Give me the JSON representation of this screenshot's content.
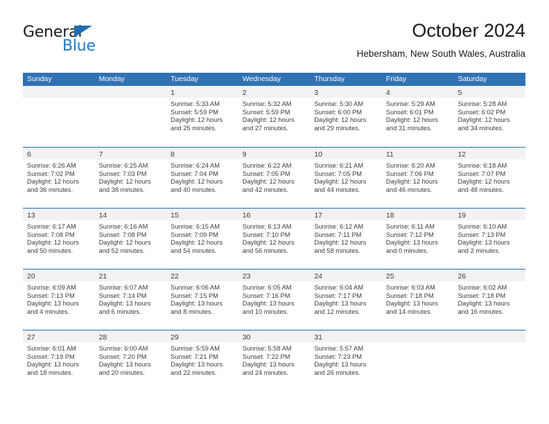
{
  "brand": {
    "word_one": "General",
    "word_two": "Blue",
    "triangle_color": "#1f6cb0",
    "blue_text_color": "#1f7ac4"
  },
  "header": {
    "title": "October 2024",
    "location": "Hebersham, New South Wales, Australia"
  },
  "theme": {
    "header_blue": "#3072b4",
    "rule_blue": "#1f6cb0",
    "daynum_strip_gray": "#f2f2f2",
    "text_color": "#3c3c3c"
  },
  "calendar": {
    "day_names": [
      "Sunday",
      "Monday",
      "Tuesday",
      "Wednesday",
      "Thursday",
      "Friday",
      "Saturday"
    ],
    "weeks": [
      [
        {
          "day": "",
          "lines": []
        },
        {
          "day": "",
          "lines": []
        },
        {
          "day": "1",
          "lines": [
            "Sunrise: 5:33 AM",
            "Sunset: 5:59 PM",
            "Daylight: 12 hours",
            "and 25 minutes."
          ]
        },
        {
          "day": "2",
          "lines": [
            "Sunrise: 5:32 AM",
            "Sunset: 5:59 PM",
            "Daylight: 12 hours",
            "and 27 minutes."
          ]
        },
        {
          "day": "3",
          "lines": [
            "Sunrise: 5:30 AM",
            "Sunset: 6:00 PM",
            "Daylight: 12 hours",
            "and 29 minutes."
          ]
        },
        {
          "day": "4",
          "lines": [
            "Sunrise: 5:29 AM",
            "Sunset: 6:01 PM",
            "Daylight: 12 hours",
            "and 31 minutes."
          ]
        },
        {
          "day": "5",
          "lines": [
            "Sunrise: 5:28 AM",
            "Sunset: 6:02 PM",
            "Daylight: 12 hours",
            "and 34 minutes."
          ]
        }
      ],
      [
        {
          "day": "6",
          "lines": [
            "Sunrise: 6:26 AM",
            "Sunset: 7:02 PM",
            "Daylight: 12 hours",
            "and 36 minutes."
          ]
        },
        {
          "day": "7",
          "lines": [
            "Sunrise: 6:25 AM",
            "Sunset: 7:03 PM",
            "Daylight: 12 hours",
            "and 38 minutes."
          ]
        },
        {
          "day": "8",
          "lines": [
            "Sunrise: 6:24 AM",
            "Sunset: 7:04 PM",
            "Daylight: 12 hours",
            "and 40 minutes."
          ]
        },
        {
          "day": "9",
          "lines": [
            "Sunrise: 6:22 AM",
            "Sunset: 7:05 PM",
            "Daylight: 12 hours",
            "and 42 minutes."
          ]
        },
        {
          "day": "10",
          "lines": [
            "Sunrise: 6:21 AM",
            "Sunset: 7:05 PM",
            "Daylight: 12 hours",
            "and 44 minutes."
          ]
        },
        {
          "day": "11",
          "lines": [
            "Sunrise: 6:20 AM",
            "Sunset: 7:06 PM",
            "Daylight: 12 hours",
            "and 46 minutes."
          ]
        },
        {
          "day": "12",
          "lines": [
            "Sunrise: 6:18 AM",
            "Sunset: 7:07 PM",
            "Daylight: 12 hours",
            "and 48 minutes."
          ]
        }
      ],
      [
        {
          "day": "13",
          "lines": [
            "Sunrise: 6:17 AM",
            "Sunset: 7:08 PM",
            "Daylight: 12 hours",
            "and 50 minutes."
          ]
        },
        {
          "day": "14",
          "lines": [
            "Sunrise: 6:16 AM",
            "Sunset: 7:08 PM",
            "Daylight: 12 hours",
            "and 52 minutes."
          ]
        },
        {
          "day": "15",
          "lines": [
            "Sunrise: 6:15 AM",
            "Sunset: 7:09 PM",
            "Daylight: 12 hours",
            "and 54 minutes."
          ]
        },
        {
          "day": "16",
          "lines": [
            "Sunrise: 6:13 AM",
            "Sunset: 7:10 PM",
            "Daylight: 12 hours",
            "and 56 minutes."
          ]
        },
        {
          "day": "17",
          "lines": [
            "Sunrise: 6:12 AM",
            "Sunset: 7:11 PM",
            "Daylight: 12 hours",
            "and 58 minutes."
          ]
        },
        {
          "day": "18",
          "lines": [
            "Sunrise: 6:11 AM",
            "Sunset: 7:12 PM",
            "Daylight: 13 hours",
            "and 0 minutes."
          ]
        },
        {
          "day": "19",
          "lines": [
            "Sunrise: 6:10 AM",
            "Sunset: 7:13 PM",
            "Daylight: 13 hours",
            "and 2 minutes."
          ]
        }
      ],
      [
        {
          "day": "20",
          "lines": [
            "Sunrise: 6:09 AM",
            "Sunset: 7:13 PM",
            "Daylight: 13 hours",
            "and 4 minutes."
          ]
        },
        {
          "day": "21",
          "lines": [
            "Sunrise: 6:07 AM",
            "Sunset: 7:14 PM",
            "Daylight: 13 hours",
            "and 6 minutes."
          ]
        },
        {
          "day": "22",
          "lines": [
            "Sunrise: 6:06 AM",
            "Sunset: 7:15 PM",
            "Daylight: 13 hours",
            "and 8 minutes."
          ]
        },
        {
          "day": "23",
          "lines": [
            "Sunrise: 6:05 AM",
            "Sunset: 7:16 PM",
            "Daylight: 13 hours",
            "and 10 minutes."
          ]
        },
        {
          "day": "24",
          "lines": [
            "Sunrise: 6:04 AM",
            "Sunset: 7:17 PM",
            "Daylight: 13 hours",
            "and 12 minutes."
          ]
        },
        {
          "day": "25",
          "lines": [
            "Sunrise: 6:03 AM",
            "Sunset: 7:18 PM",
            "Daylight: 13 hours",
            "and 14 minutes."
          ]
        },
        {
          "day": "26",
          "lines": [
            "Sunrise: 6:02 AM",
            "Sunset: 7:18 PM",
            "Daylight: 13 hours",
            "and 16 minutes."
          ]
        }
      ],
      [
        {
          "day": "27",
          "lines": [
            "Sunrise: 6:01 AM",
            "Sunset: 7:19 PM",
            "Daylight: 13 hours",
            "and 18 minutes."
          ]
        },
        {
          "day": "28",
          "lines": [
            "Sunrise: 6:00 AM",
            "Sunset: 7:20 PM",
            "Daylight: 13 hours",
            "and 20 minutes."
          ]
        },
        {
          "day": "29",
          "lines": [
            "Sunrise: 5:59 AM",
            "Sunset: 7:21 PM",
            "Daylight: 13 hours",
            "and 22 minutes."
          ]
        },
        {
          "day": "30",
          "lines": [
            "Sunrise: 5:58 AM",
            "Sunset: 7:22 PM",
            "Daylight: 13 hours",
            "and 24 minutes."
          ]
        },
        {
          "day": "31",
          "lines": [
            "Sunrise: 5:57 AM",
            "Sunset: 7:23 PM",
            "Daylight: 13 hours",
            "and 26 minutes."
          ]
        },
        {
          "day": "",
          "lines": []
        },
        {
          "day": "",
          "lines": []
        }
      ]
    ]
  }
}
